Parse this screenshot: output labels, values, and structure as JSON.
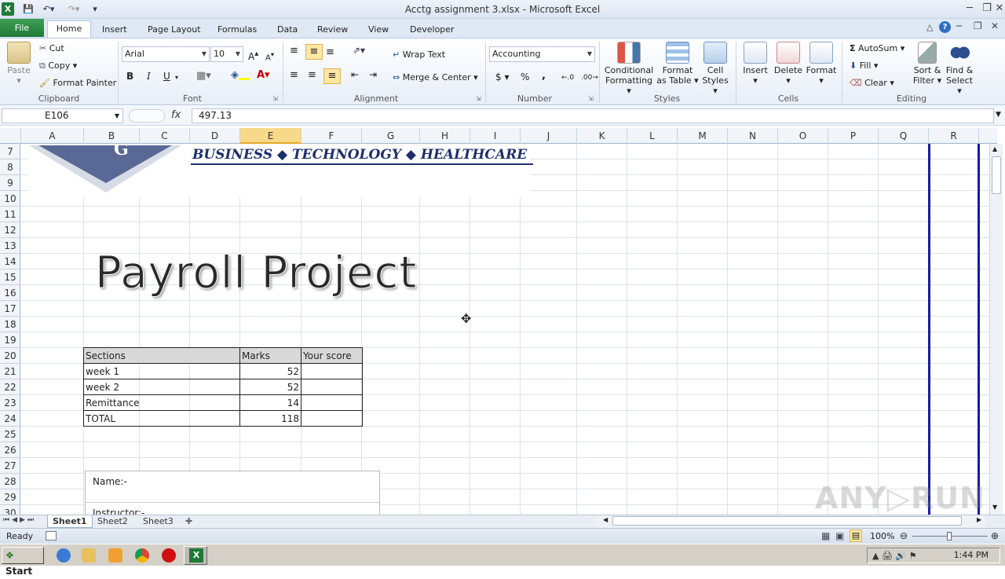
{
  "window": {
    "title": "Acctg assignment 3.xlsx  -  Microsoft Excel"
  },
  "ribbon": {
    "file_tab": "File",
    "tabs": [
      "Home",
      "Insert",
      "Page Layout",
      "Formulas",
      "Data",
      "Review",
      "View",
      "Developer"
    ],
    "active_tab": "Home",
    "clipboard": {
      "paste": "Paste",
      "cut": "Cut",
      "copy": "Copy",
      "format_painter": "Format Painter",
      "label": "Clipboard"
    },
    "font": {
      "name": "Arial",
      "size": "10",
      "label": "Font",
      "bold": "B",
      "italic": "I",
      "underline": "U"
    },
    "alignment": {
      "wrap_text": "Wrap Text",
      "merge_center": "Merge & Center",
      "label": "Alignment"
    },
    "number": {
      "format": "Accounting",
      "currency": "$",
      "percent": "%",
      "comma": ",",
      "label": "Number"
    },
    "styles": {
      "conditional": "Conditional",
      "formatting": "Formatting",
      "format_as": "Format",
      "as_table": "as Table",
      "cell": "Cell",
      "cell_styles": "Styles",
      "label": "Styles"
    },
    "cells": {
      "insert": "Insert",
      "delete": "Delete",
      "format": "Format",
      "label": "Cells"
    },
    "editing": {
      "autosum": "AutoSum",
      "fill": "Fill",
      "clear": "Clear",
      "sort": "Sort &",
      "filter": "Filter",
      "find": "Find &",
      "select": "Select",
      "label": "Editing"
    }
  },
  "formula_bar": {
    "name_box": "E106",
    "fx": "fx",
    "value": "497.13"
  },
  "grid": {
    "columns": [
      "A",
      "B",
      "C",
      "D",
      "E",
      "F",
      "G",
      "H",
      "I",
      "J",
      "K",
      "L",
      "M",
      "N",
      "O",
      "P",
      "Q",
      "R"
    ],
    "selected_column": "E",
    "rows": [
      "7",
      "8",
      "9",
      "10",
      "11",
      "12",
      "13",
      "14",
      "15",
      "16",
      "17",
      "18",
      "19",
      "20",
      "21",
      "22",
      "23",
      "24",
      "25",
      "26",
      "27",
      "28",
      "29",
      "30"
    ]
  },
  "sheet": {
    "banner": "BUSINESS  ◆  TECHNOLOGY  ◆  HEALTHCARE",
    "title": "Payroll Project",
    "table": {
      "headers": [
        "Sections",
        "Marks",
        "Your score"
      ],
      "rows": [
        [
          "week 1",
          "52",
          ""
        ],
        [
          "week 2",
          "52",
          ""
        ],
        [
          "Remittance",
          "14",
          ""
        ],
        [
          "TOTAL",
          "118",
          ""
        ]
      ]
    },
    "name_label": "Name:-",
    "instructor_label": "Instructor:-"
  },
  "sheet_tabs": [
    "Sheet1",
    "Sheet2",
    "Sheet3"
  ],
  "active_sheet": "Sheet1",
  "status": {
    "ready": "Ready",
    "zoom": "100%"
  },
  "taskbar": {
    "start": "Start",
    "time": "1:44 PM"
  },
  "watermark": "ANY▷RUN"
}
